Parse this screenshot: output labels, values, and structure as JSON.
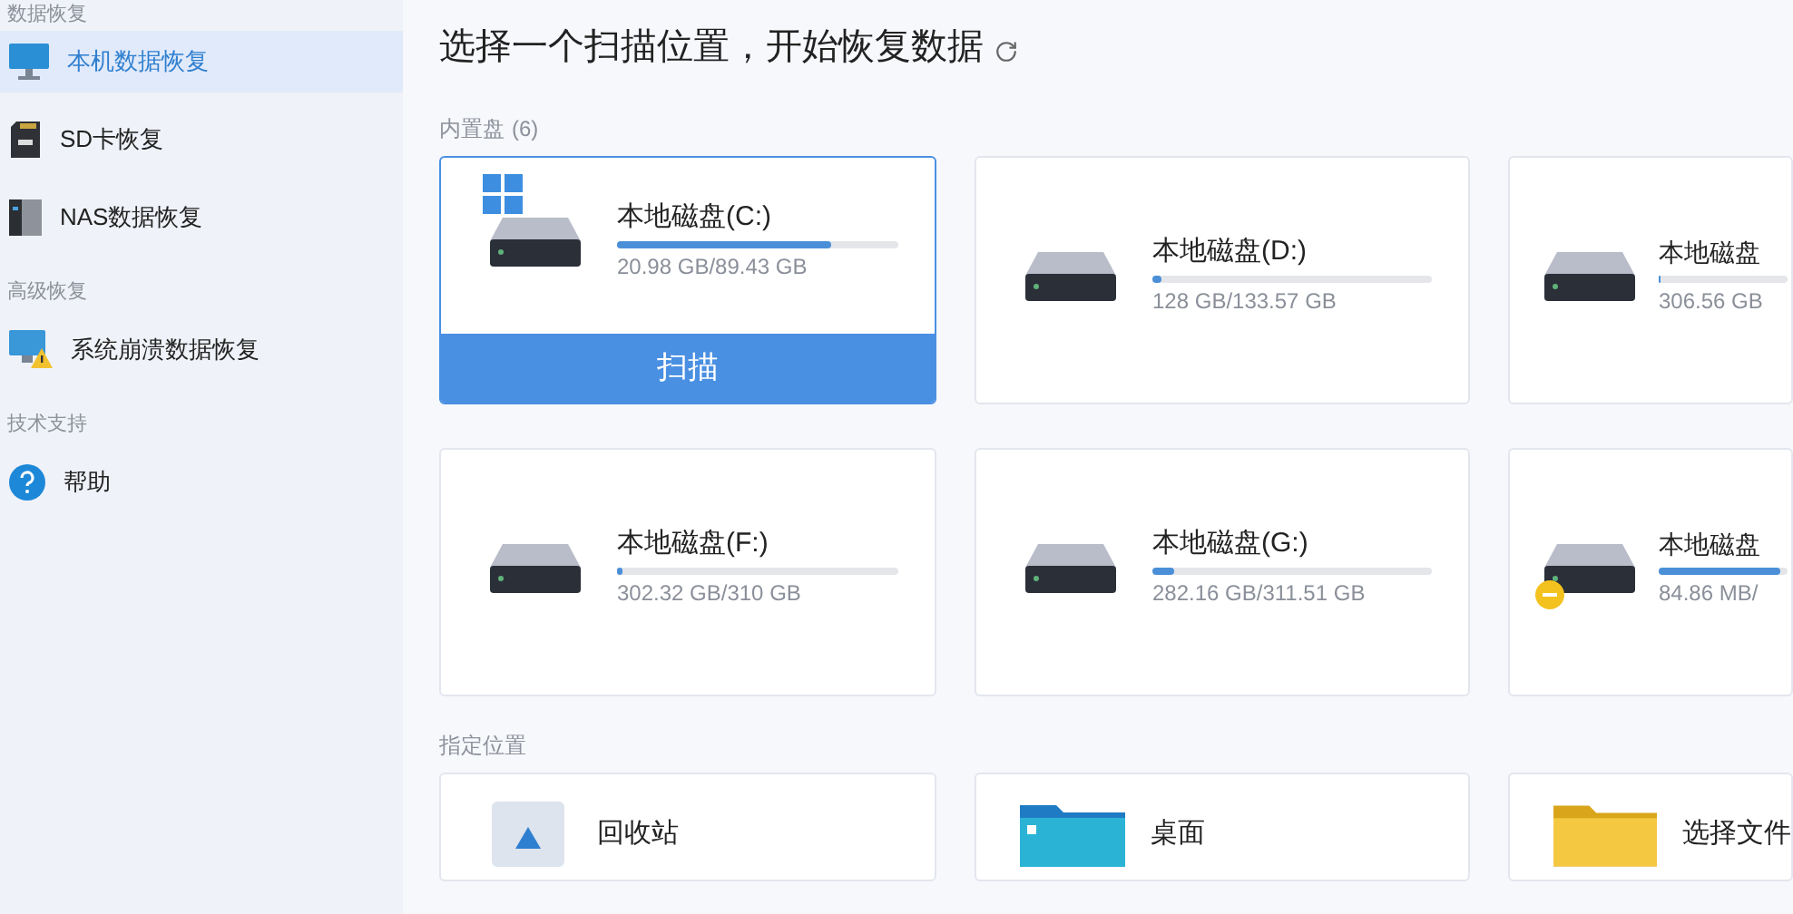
{
  "sidebar": {
    "sections": [
      {
        "label": "数据恢复",
        "items": [
          {
            "label": "本机数据恢复",
            "selected": true
          },
          {
            "label": "SD卡恢复",
            "selected": false
          },
          {
            "label": "NAS数据恢复",
            "selected": false
          }
        ]
      },
      {
        "label": "高级恢复",
        "items": [
          {
            "label": "系统崩溃数据恢复",
            "selected": false
          }
        ]
      },
      {
        "label": "技术支持",
        "items": [
          {
            "label": "帮助",
            "selected": false
          }
        ]
      }
    ]
  },
  "title": "选择一个扫描位置，开始恢复数据",
  "drives_section": {
    "label": "内置盘",
    "count": "(6)"
  },
  "drives": [
    {
      "name": "本地磁盘(C:)",
      "usage": "20.98 GB/89.43 GB",
      "level": 0.76,
      "system": true,
      "warning": false,
      "selected": true,
      "action": "扫描"
    },
    {
      "name": "本地磁盘(D:)",
      "usage": "128 GB/133.57 GB",
      "level": 0.03,
      "system": false,
      "warning": false,
      "selected": false
    },
    {
      "name": "本地磁盘",
      "usage": "306.56 GB",
      "level": 0.02,
      "system": false,
      "warning": false,
      "selected": false
    },
    {
      "name": "本地磁盘(F:)",
      "usage": "302.32 GB/310 GB",
      "level": 0.02,
      "system": false,
      "warning": false,
      "selected": false
    },
    {
      "name": "本地磁盘(G:)",
      "usage": "282.16 GB/311.51 GB",
      "level": 0.08,
      "system": false,
      "warning": false,
      "selected": false
    },
    {
      "name": "本地磁盘",
      "usage": "84.86 MB/",
      "level": 0.95,
      "system": false,
      "warning": true,
      "selected": false
    }
  ],
  "locations_section": {
    "label": "指定位置"
  },
  "locations": [
    {
      "kind": "recycle",
      "label": "回收站"
    },
    {
      "kind": "desktop",
      "label": "桌面"
    },
    {
      "kind": "folder",
      "label": "选择文件"
    }
  ]
}
